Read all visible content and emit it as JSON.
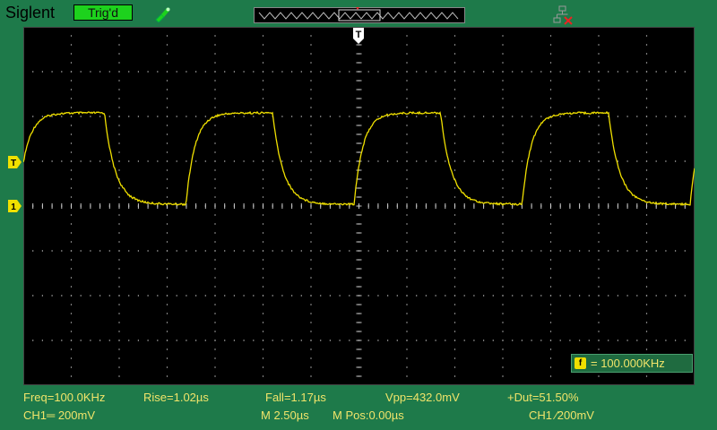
{
  "header": {
    "brand": "Siglent",
    "trigger_status": "Trig'd",
    "status_color": "#1dd21d",
    "icons": [
      "probe-icon",
      "timeline-icon",
      "network-disconnected-icon"
    ]
  },
  "markers": {
    "trigger_level": "T",
    "channel1": "1",
    "trigger_position": "T"
  },
  "measurements": {
    "freq": "Freq=100.0KHz",
    "rise": "Rise=1.02µs",
    "fall": "Fall=1.17µs",
    "vpp": "Vpp=432.0mV",
    "duty": "+Dut=51.50%"
  },
  "counter": {
    "icon_label": "f",
    "value": "= 100.000KHz"
  },
  "status_bar": {
    "ch1_scale": "CH1═ 200mV",
    "timebase": "M 2.50µs",
    "mpos": "M Pos:0.00µs",
    "trigger": "CH1 ⁄200mV"
  },
  "colors": {
    "background": "#1e7a4a",
    "trace": "#f0e000",
    "text": "#f0e46a",
    "grid": "#cccccc"
  }
}
